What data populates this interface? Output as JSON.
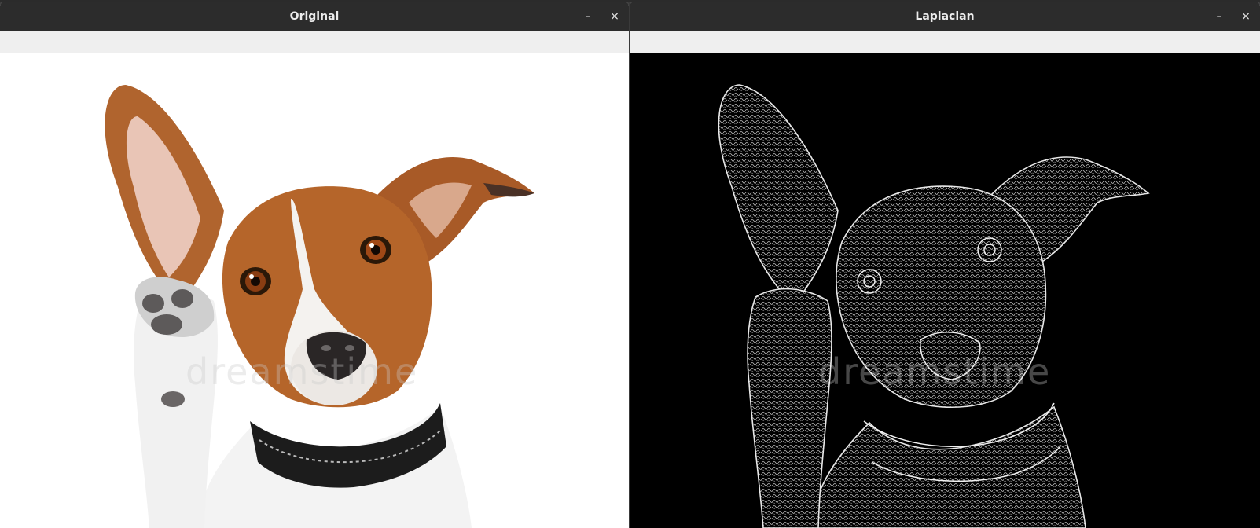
{
  "windows": [
    {
      "title": "Original",
      "controls": {
        "minimize": "–",
        "close": "×"
      },
      "watermark": "dreamstime"
    },
    {
      "title": "Laplacian",
      "controls": {
        "minimize": "–",
        "close": "×"
      },
      "watermark": "dreamstime"
    }
  ],
  "colors": {
    "titlebar": "#2c2c2c",
    "toolbar": "#efefef",
    "original_bg": "#ffffff",
    "laplacian_bg": "#000000",
    "dog_tan": "#b5652a",
    "dog_white": "#f2f2f2",
    "collar": "#1c1c1c"
  }
}
